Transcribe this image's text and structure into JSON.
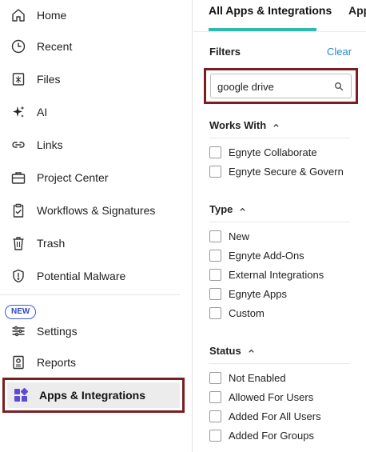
{
  "sidebar": {
    "items": [
      {
        "label": "Home",
        "icon": "home-icon"
      },
      {
        "label": "Recent",
        "icon": "clock-icon"
      },
      {
        "label": "Files",
        "icon": "files-icon"
      },
      {
        "label": "AI",
        "icon": "sparkle-icon"
      },
      {
        "label": "Links",
        "icon": "link-icon"
      },
      {
        "label": "Project Center",
        "icon": "briefcase-icon"
      },
      {
        "label": "Workflows & Signatures",
        "icon": "clipboard-check-icon"
      },
      {
        "label": "Trash",
        "icon": "trash-icon"
      },
      {
        "label": "Potential Malware",
        "icon": "shield-alert-icon"
      },
      {
        "label": "Settings",
        "icon": "sliders-icon"
      },
      {
        "label": "Reports",
        "icon": "reports-icon"
      },
      {
        "label": "Apps & Integrations",
        "icon": "apps-grid-icon"
      }
    ],
    "new_badge": "NEW",
    "accent_color": "#5b4bd6"
  },
  "tabs": [
    {
      "label": "All Apps & Integrations",
      "active": true
    },
    {
      "label": "App"
    }
  ],
  "filters": {
    "title": "Filters",
    "clear_label": "Clear",
    "search_value": "google drive",
    "search_placeholder": "",
    "sections": [
      {
        "title": "Works With",
        "options": [
          "Egnyte Collaborate",
          "Egnyte Secure & Govern"
        ]
      },
      {
        "title": "Type",
        "options": [
          "New",
          "Egnyte Add-Ons",
          "External Integrations",
          "Egnyte Apps",
          "Custom"
        ]
      },
      {
        "title": "Status",
        "options": [
          "Not Enabled",
          "Allowed For Users",
          "Added For All Users",
          "Added For Groups"
        ]
      }
    ]
  },
  "colors": {
    "highlight_border": "#7b1e22",
    "tab_underline": "#2fb9b0",
    "link": "#2a88c8"
  }
}
